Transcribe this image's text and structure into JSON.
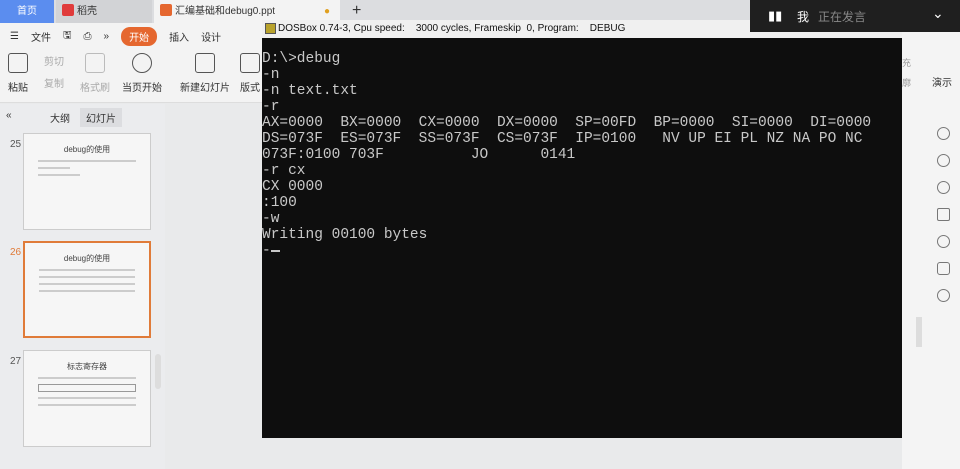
{
  "tabs": {
    "home": "首页",
    "daoke": "稻壳",
    "doc": "汇编基础和debug0.ppt",
    "new": "+"
  },
  "menu": {
    "file": "文件",
    "start": "开始",
    "insert": "插入",
    "design": "设计"
  },
  "toolbar": {
    "paste": "粘贴",
    "cut": "剪切",
    "copy": "复制",
    "format_painter": "格式刷",
    "play_from_current": "当页开始",
    "new_slide": "新建幻灯片",
    "layout": "版式",
    "fill": "充",
    "outline": "廓",
    "presentation": "演示"
  },
  "left_pane": {
    "outline_tab": "大纲",
    "slides_tab": "幻灯片",
    "collapse": "«"
  },
  "slides": [
    {
      "number": "25",
      "title": "debug的使用",
      "selected": false
    },
    {
      "number": "26",
      "title": "debug的使用",
      "selected": true
    },
    {
      "number": "27",
      "title": "标志寄存器",
      "selected": false
    }
  ],
  "dosbox": {
    "title": "DOSBox 0.74-3, Cpu speed:    3000 cycles, Frameskip  0, Program:    DEBUG",
    "lines": [
      "D:\\>debug",
      "-n",
      "-n text.txt",
      "-r",
      "AX=0000  BX=0000  CX=0000  DX=0000  SP=00FD  BP=0000  SI=0000  DI=0000",
      "DS=073F  ES=073F  SS=073F  CS=073F  IP=0100   NV UP EI PL NZ NA PO NC",
      "073F:0100 703F          JO      0141",
      "-r cx",
      "CX 0000",
      ":100",
      "-w",
      "Writing 00100 bytes",
      "-"
    ]
  },
  "meeting": {
    "me": "我",
    "status": "正在发言"
  }
}
